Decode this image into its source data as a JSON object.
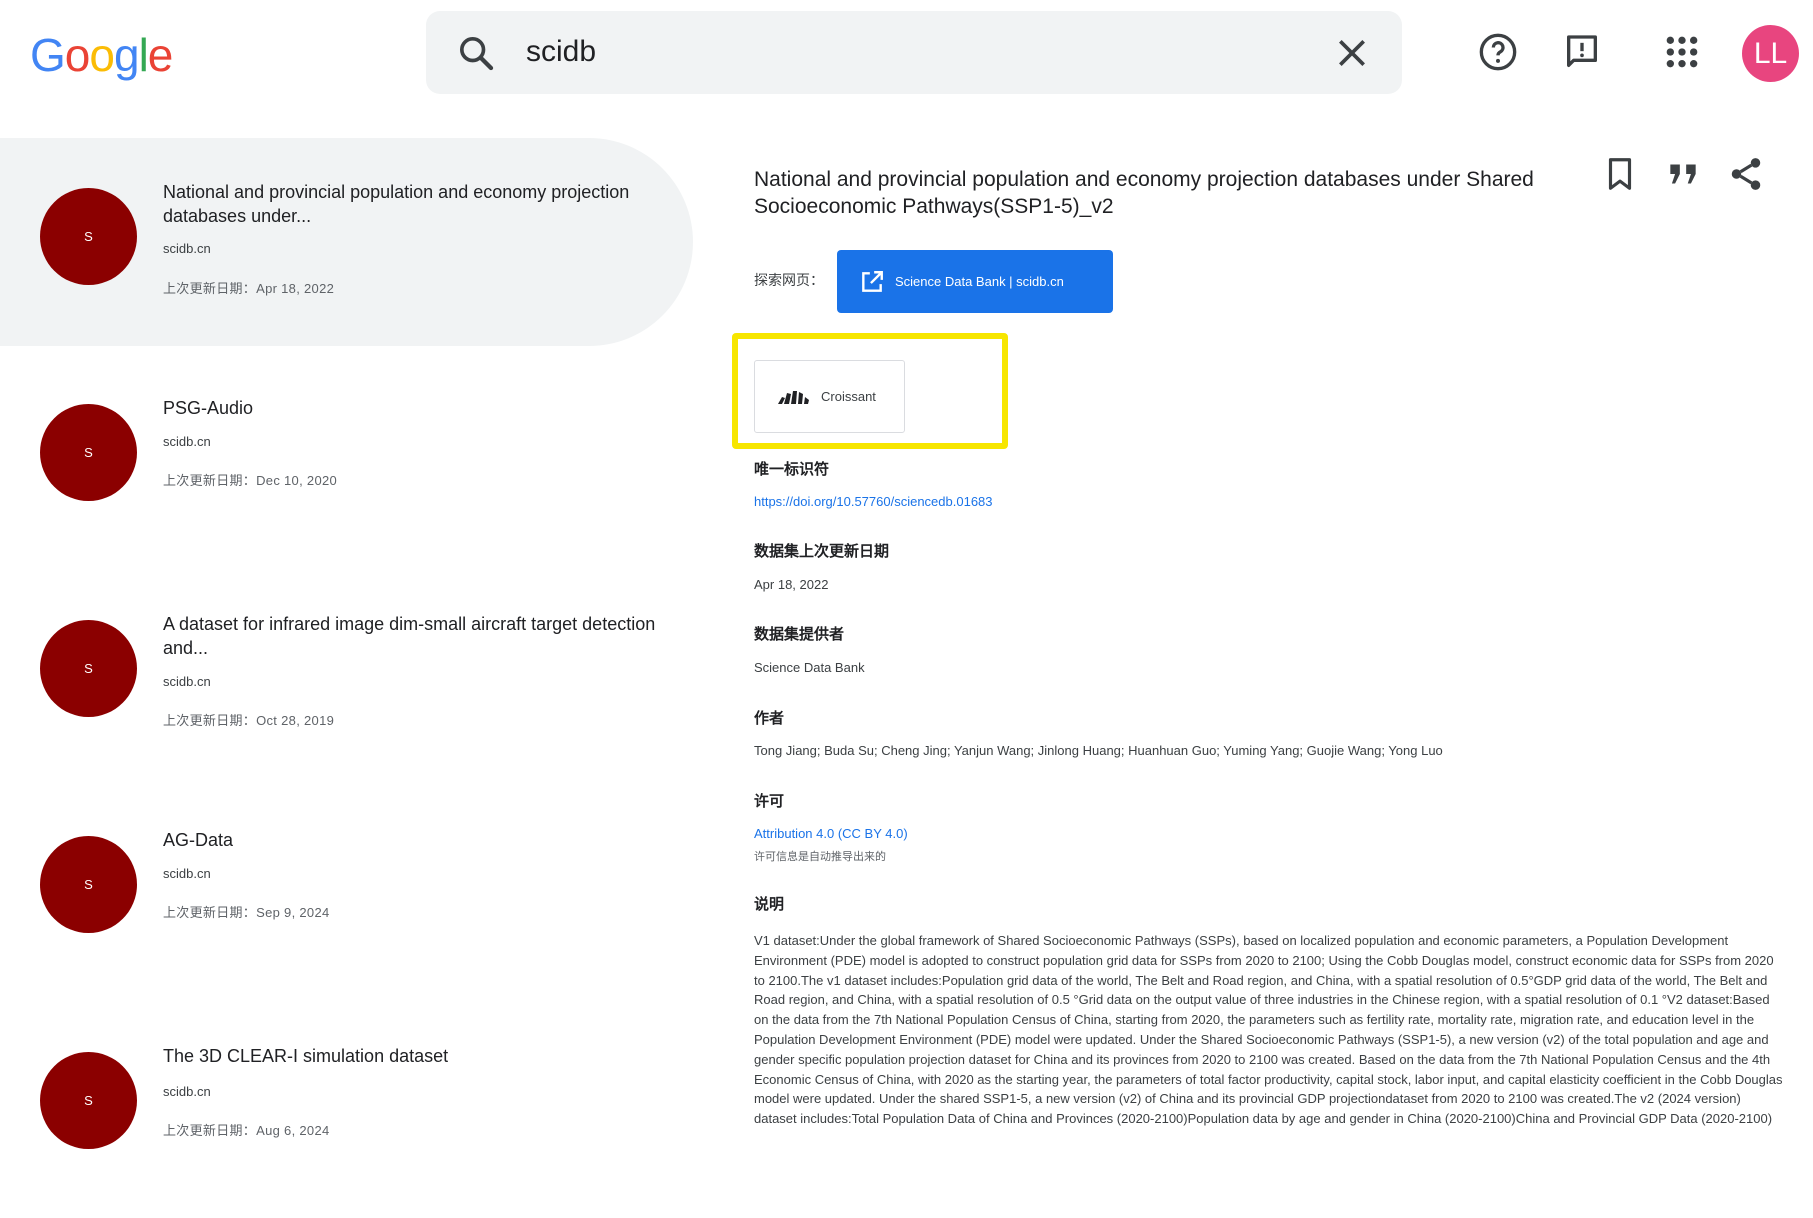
{
  "header": {
    "logo_letters": [
      {
        "char": "G",
        "color": "#4285F4"
      },
      {
        "char": "o",
        "color": "#EA4335"
      },
      {
        "char": "o",
        "color": "#FBBC05"
      },
      {
        "char": "g",
        "color": "#4285F4"
      },
      {
        "char": "l",
        "color": "#34A853"
      },
      {
        "char": "e",
        "color": "#EA4335"
      }
    ],
    "search_value": "scidb",
    "avatar_initials": "LL",
    "avatar_color": "#e8457f",
    "icons": [
      "search-icon",
      "clear-icon",
      "help-icon",
      "feedback-icon",
      "apps-icon"
    ]
  },
  "results": [
    {
      "avatar": "S",
      "title": "National and provincial population and economy projection databases under...",
      "site": "scidb.cn",
      "date": "上次更新日期：Apr 18, 2022"
    },
    {
      "avatar": "S",
      "title": "PSG-Audio",
      "site": "scidb.cn",
      "date": "上次更新日期：Dec 10, 2020"
    },
    {
      "avatar": "S",
      "title": "A dataset for infrared image dim-small aircraft target detection and...",
      "site": "scidb.cn",
      "date": "上次更新日期：Oct 28, 2019"
    },
    {
      "avatar": "S",
      "title": "AG-Data",
      "site": "scidb.cn",
      "date": "上次更新日期：Sep 9, 2024"
    },
    {
      "avatar": "S",
      "title": "The 3D CLEAR-I simulation dataset",
      "site": "scidb.cn",
      "date": "上次更新日期：Aug 6, 2024"
    }
  ],
  "detail": {
    "title": "National and provincial population and economy projection databases under Shared Socioeconomic Pathways(SSP1-5)_v2",
    "explore_label": "探索网页：",
    "explore_button": "Science Data Bank | scidb.cn",
    "croissant_label": "Croissant",
    "identifier_heading": "唯一标识符",
    "identifier_value": "https://doi.org/10.57760/sciencedb.01683",
    "updated_heading": "数据集上次更新日期",
    "updated_value": "Apr 18, 2022",
    "provider_heading": "数据集提供者",
    "provider_value": "Science Data Bank",
    "authors_heading": "作者",
    "authors_value": "Tong Jiang; Buda Su; Cheng Jing; Yanjun Wang; Jinlong Huang; Huanhuan Guo; Yuming Yang; Guojie Wang; Yong Luo",
    "license_heading": "许可",
    "license_value": "Attribution 4.0 (CC BY 4.0)",
    "license_note": "许可信息是自动推导出来的",
    "description_heading": "说明",
    "description": "V1 dataset:Under the global framework of Shared Socioeconomic Pathways (SSPs), based on localized population and economic parameters, a Population Development Environment (PDE) model is adopted to construct population grid data for SSPs from 2020 to 2100; Using the Cobb Douglas model, construct economic data for SSPs from 2020 to 2100.The v1 dataset includes:Population grid data of the world, The Belt and Road region, and China, with a spatial resolution of 0.5°GDP grid data of the world, The Belt and Road region, and China, with a spatial resolution of 0.5 °Grid data on the output value of three industries in the Chinese region, with a spatial resolution of 0.1 °V2 dataset:Based on the data from the 7th National Population Census of China, starting from 2020, the parameters such as fertility rate, mortality rate, migration rate, and education level in the Population Development Environment (PDE) model were updated. Under the Shared Socioeconomic Pathways (SSP1-5), a new version (v2) of the total population and age and gender specific population projection dataset for China and its provinces from 2020 to 2100 was created. Based on the data from the 7th National Population Census and the 4th Economic Census of China, with 2020 as the starting year, the parameters of total factor productivity, capital stock, labor input, and capital elasticity coefficient in the Cobb Douglas model were updated. Under the shared SSP1-5, a new version (v2) of China and its provincial GDP projectiondataset from 2020 to 2100 was created.The v2 (2024 version) dataset includes:Total Population Data of China and Provinces (2020-2100)Population data by age and gender in China (2020-2100)China and Provincial GDP Data (2020-2100)",
    "accent_color": "#1a73e8",
    "highlight_color": "#f7e600",
    "result_avatar_color": "#8b0000"
  }
}
